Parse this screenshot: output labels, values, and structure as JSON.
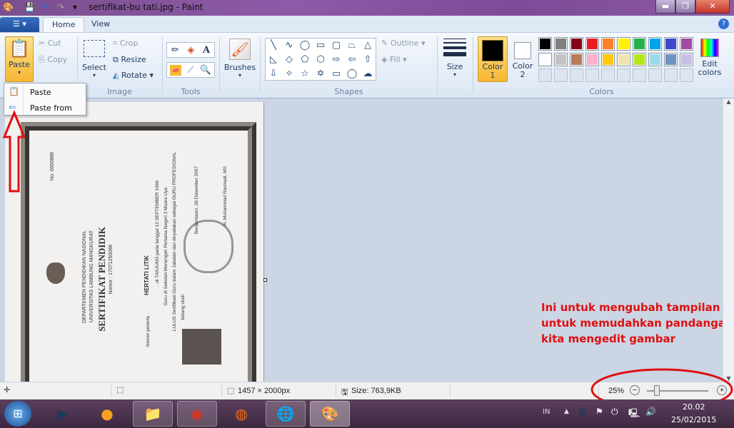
{
  "window": {
    "title": "sertifikat-bu tati.jpg - Paint",
    "minimize": "▬",
    "restore": "❐",
    "close": "✕"
  },
  "tabs": [
    {
      "label": "Home"
    },
    {
      "label": "View"
    }
  ],
  "clipboard": {
    "paste": "Paste",
    "cut": "Cut",
    "copy": "Copy",
    "menu": [
      {
        "label": "Paste"
      },
      {
        "label": "Paste from"
      }
    ]
  },
  "image": {
    "select": "Select",
    "crop": "Crop",
    "resize": "Resize",
    "rotate": "Rotate",
    "group": "Image"
  },
  "tools": {
    "group": "Tools"
  },
  "brushes": {
    "label": "Brushes"
  },
  "shapes": {
    "outline": "Outline",
    "fill": "Fill",
    "group": "Shapes",
    "glyphs": [
      "╲",
      "∿",
      "◯",
      "▭",
      "▢",
      "⏢",
      "△",
      "◺",
      "◇",
      "⬠",
      "⬡",
      "⇨",
      "⇦",
      "⇧",
      "⇩",
      "✧",
      "☆",
      "✡",
      "▭",
      "◯",
      "☁"
    ]
  },
  "size": {
    "label": "Size"
  },
  "colors": {
    "color1": "Color 1",
    "color2": "Color 2",
    "edit": "Edit colors",
    "group": "Colors",
    "color1_value": "#000000",
    "color2_value": "#ffffff",
    "palette_row1": [
      "#000000",
      "#7f7f7f",
      "#880015",
      "#ed1c24",
      "#ff7f27",
      "#fff200",
      "#22b14c",
      "#00a2e8",
      "#3f48cc",
      "#a349a4"
    ],
    "palette_row2": [
      "#ffffff",
      "#c3c3c3",
      "#b97a57",
      "#ffaec9",
      "#ffc90e",
      "#efe4b0",
      "#b5e61d",
      "#99d9ea",
      "#7092be",
      "#c8bfe7"
    ]
  },
  "certificate": {
    "number": "No. 0000886",
    "dept": "DEPARTEMEN PENDIDIKAN NASIONAL",
    "univ": "UNIVERSITAS LAMBUNG MANGKURAT",
    "title": "SERTIFIKAT PENDIDIK",
    "nomor": "Nomor : 17071250088",
    "name": "HERTATI LITIK",
    "line1": "...di TANJUNG pada tanggal 12 SEPTEMBER 1966",
    "line2": "Guru di Sekolah Menengah Pertama Negeri 3 Muara Uya",
    "line3": "LULUS Sertifikasi Guru dalam Jabatan dan dinyatakan sebagai GURU PROFESIONAL",
    "line4": "bidang studi",
    "date": "Banjarmasin, 28 Desember 2007",
    "signer": "H. Muhammad Rasmadi, MS",
    "peserta": "Nomor peserta"
  },
  "annotation": {
    "note": "Ini untuk mengubah tampilan untuk memudahkan pandangan kita mengedit gambar",
    "color": "#e01010"
  },
  "status": {
    "dimensions": "1457 × 2000px",
    "size": "Size: 763,9KB",
    "zoom": "25%",
    "zoom_value": 25
  },
  "tray": {
    "lang": "IN",
    "time": "20.02",
    "date": "25/02/2015"
  }
}
